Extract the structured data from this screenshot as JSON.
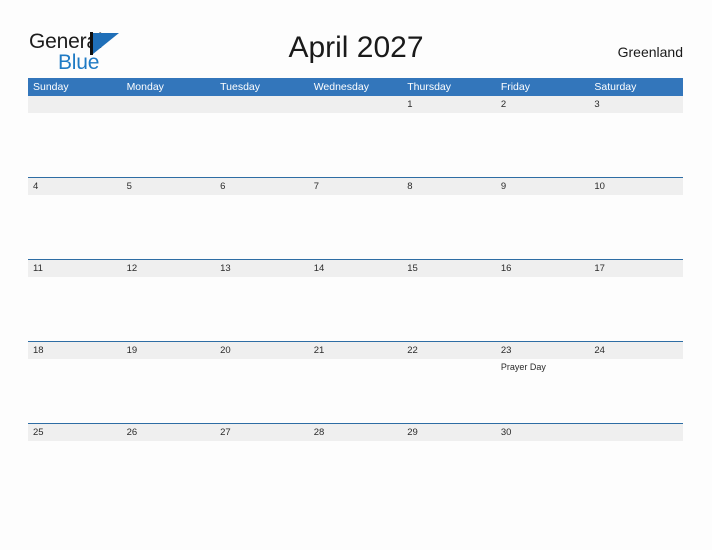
{
  "brand": {
    "name_part1": "General",
    "name_part2": "Blue",
    "logo_icon": "flag-triangle-icon",
    "accent_color": "#1f6fb8"
  },
  "header": {
    "title": "April 2027",
    "location": "Greenland"
  },
  "theme": {
    "header_blue": "#3376bb",
    "date_band_gray": "#efefef",
    "row_divider_blue": "#2e6da4",
    "page_background": "#fdfdfd",
    "text_color": "#2b2b2b"
  },
  "calendar": {
    "month": "April",
    "year": "2027",
    "weekday_headers": [
      "Sunday",
      "Monday",
      "Tuesday",
      "Wednesday",
      "Thursday",
      "Friday",
      "Saturday"
    ],
    "weeks": [
      [
        {
          "date": "",
          "events": []
        },
        {
          "date": "",
          "events": []
        },
        {
          "date": "",
          "events": []
        },
        {
          "date": "",
          "events": []
        },
        {
          "date": "1",
          "events": []
        },
        {
          "date": "2",
          "events": []
        },
        {
          "date": "3",
          "events": []
        }
      ],
      [
        {
          "date": "4",
          "events": []
        },
        {
          "date": "5",
          "events": []
        },
        {
          "date": "6",
          "events": []
        },
        {
          "date": "7",
          "events": []
        },
        {
          "date": "8",
          "events": []
        },
        {
          "date": "9",
          "events": []
        },
        {
          "date": "10",
          "events": []
        }
      ],
      [
        {
          "date": "11",
          "events": []
        },
        {
          "date": "12",
          "events": []
        },
        {
          "date": "13",
          "events": []
        },
        {
          "date": "14",
          "events": []
        },
        {
          "date": "15",
          "events": []
        },
        {
          "date": "16",
          "events": []
        },
        {
          "date": "17",
          "events": []
        }
      ],
      [
        {
          "date": "18",
          "events": []
        },
        {
          "date": "19",
          "events": []
        },
        {
          "date": "20",
          "events": []
        },
        {
          "date": "21",
          "events": []
        },
        {
          "date": "22",
          "events": []
        },
        {
          "date": "23",
          "events": [
            "Prayer Day"
          ]
        },
        {
          "date": "24",
          "events": []
        }
      ],
      [
        {
          "date": "25",
          "events": []
        },
        {
          "date": "26",
          "events": []
        },
        {
          "date": "27",
          "events": []
        },
        {
          "date": "28",
          "events": []
        },
        {
          "date": "29",
          "events": []
        },
        {
          "date": "30",
          "events": []
        },
        {
          "date": "",
          "events": []
        }
      ]
    ]
  }
}
